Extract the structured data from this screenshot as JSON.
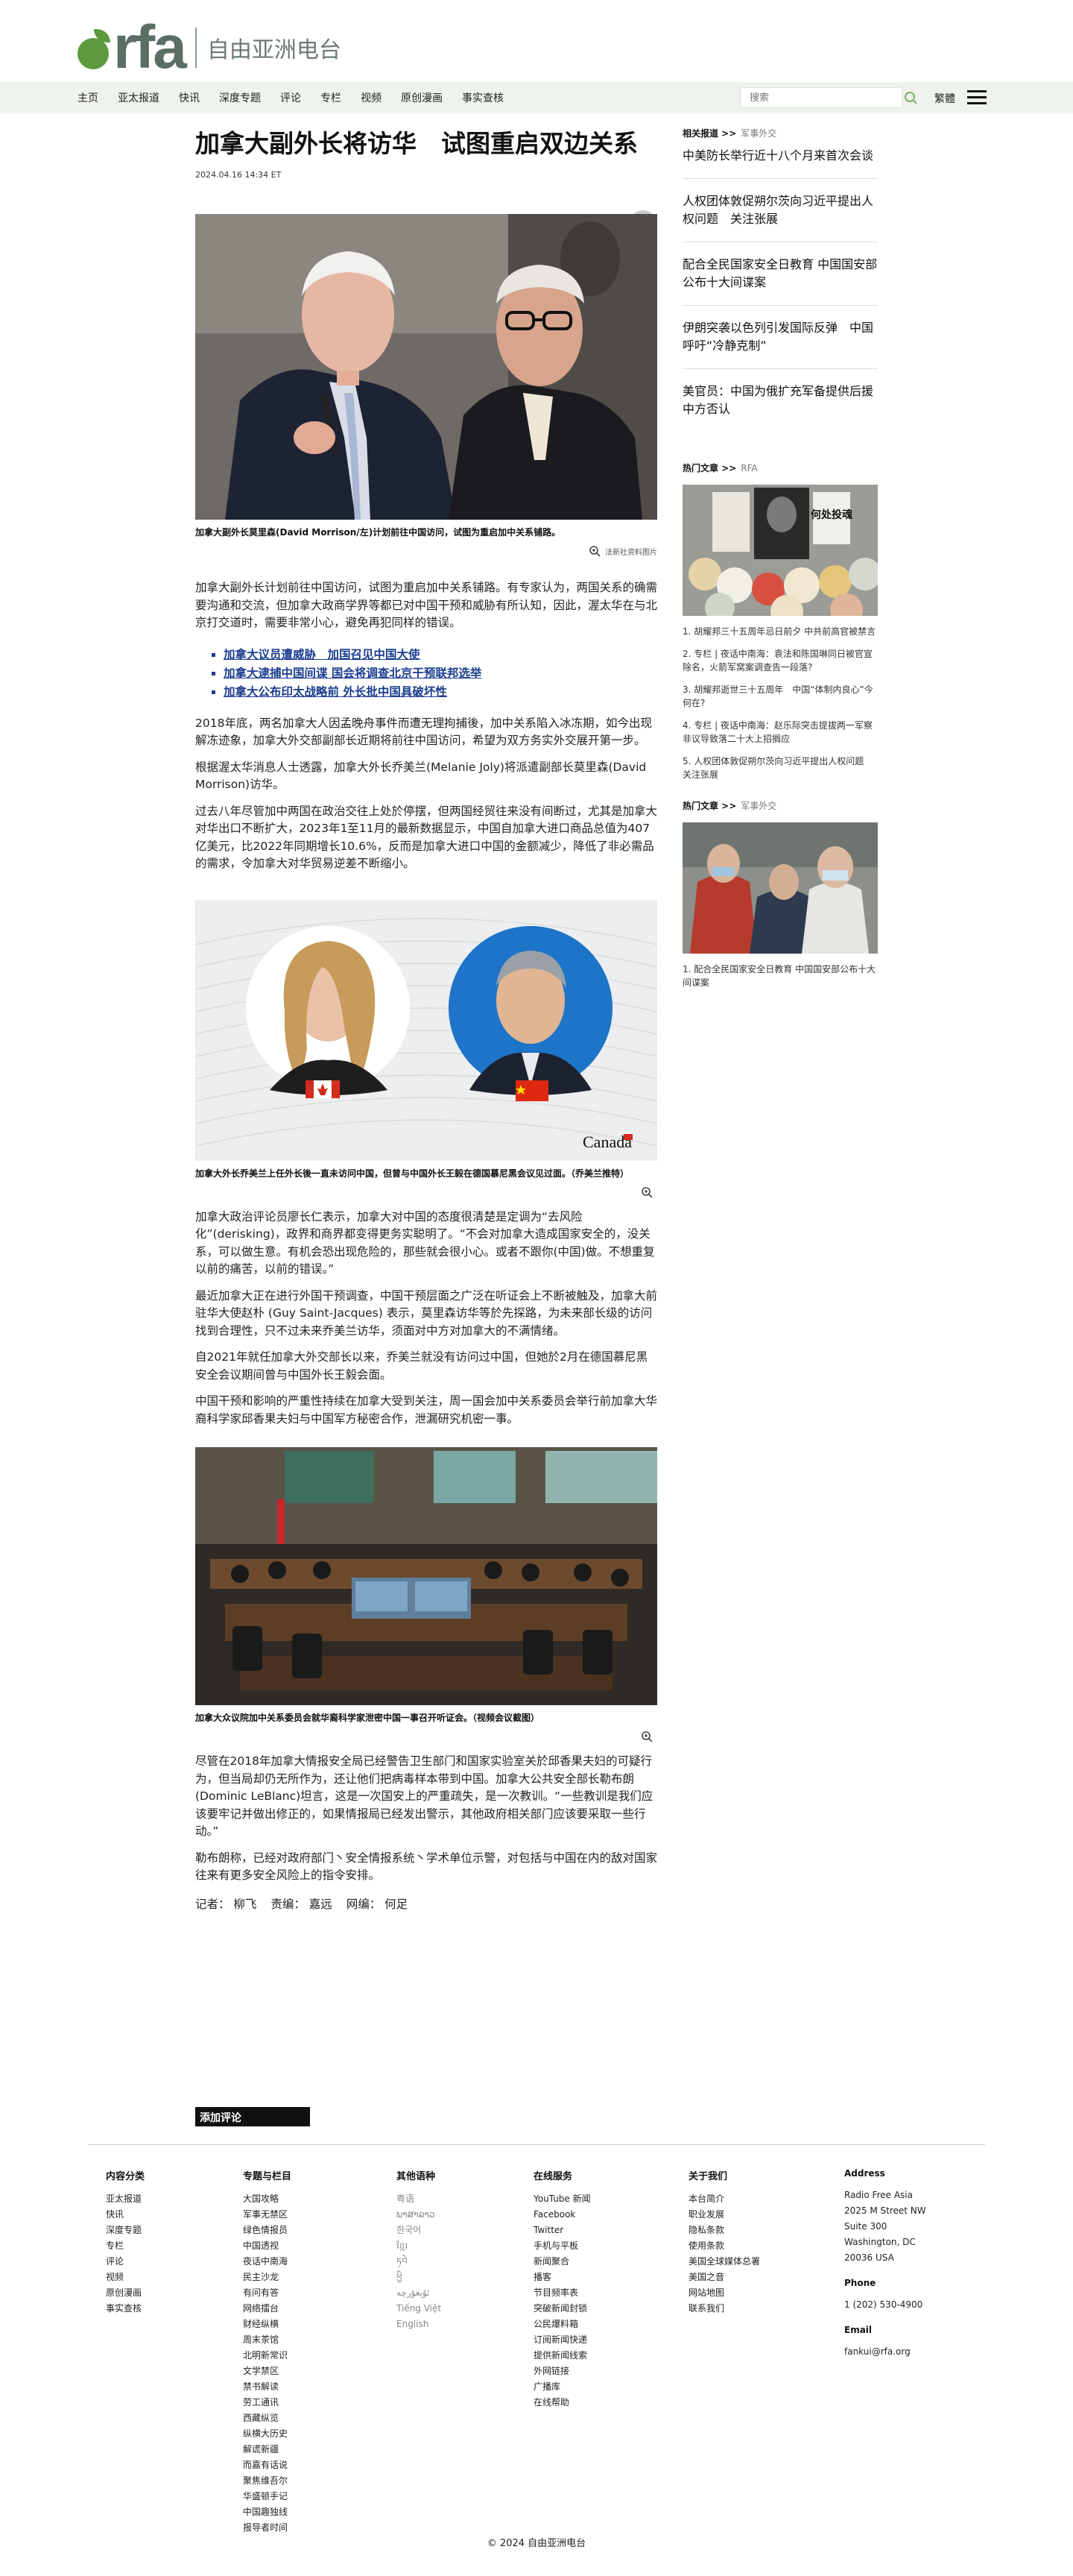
{
  "brand": {
    "logo_text": "rfa",
    "logo_cn": "自由亚洲电台"
  },
  "nav": {
    "items": [
      "主页",
      "亚太报道",
      "快讯",
      "深度专题",
      "评论",
      "专栏",
      "视频",
      "原创漫画",
      "事实查核"
    ],
    "search_placeholder": "搜索",
    "lang_label": "繁體"
  },
  "article": {
    "title": "加拿大副外长将访华　试图重启双边关系",
    "date": "2024.04.16 14:34 ET",
    "figure1": {
      "caption": "加拿大副外长莫里森(David Morrison/左)计划前往中国访问，试图为重启加中关系铺路。",
      "credit": "法新社资料图片"
    },
    "p1": "加拿大副外长计划前往中国访问，试图为重启加中关系铺路。有专家认为，两国关系的确需要沟通和交流，但加拿大政商学界等都已对中国干预和威胁有所认知，因此，渥太华在与北京打交道时，需要非常小心，避免再犯同样的错误。",
    "related": [
      "加拿大议员遭威胁　加国召见中国大使",
      "加拿大逮捕中国间谍 国会将调查北京干预联邦选举",
      "加拿大公布印太战略前 外长批中国具破坏性"
    ],
    "p2": "2018年底，两名加拿大人因孟晚舟事件而遭无理拘捕後，加中关系陷入冰冻期，如今出现解冻迹象，加拿大外交部副部长近期将前往中国访问，希望为双方务实外交展开第一步。",
    "p3": "根据渥太华消息人士透露，加拿大外长乔美兰(Melanie Joly)将派遣副部长莫里森(David Morrison)访华。",
    "p4": "过去八年尽管加中两国在政治交往上处於停摆，但两国经贸往来没有间断过，尤其是加拿大对华出口不断扩大，2023年1至11月的最新数据显示，中国自加拿大进口商品总值为407亿美元，比2022年同期增长10.6%，反而是加拿大进口中国的金额减少，降低了非必需品的需求，令加拿大对华贸易逆差不断缩小。",
    "figure2": {
      "caption": "加拿大外长乔美兰上任外长後一直未访问中国，但曾与中国外长王毅在德国慕尼黑会议见过面。（乔美兰推特）",
      "watermark": "Canada"
    },
    "p5": "加拿大政治评论员廖长仁表示，加拿大对中国的态度很清楚是定调为“去风险化”(derisking)，政界和商界都变得更务实聪明了。“不会对加拿大造成国家安全的，没关系，可以做生意。有机会恐出现危险的，那些就会很小心。或者不跟你(中国)做。不想重复以前的痛苦，以前的错误。”",
    "p6": "最近加拿大正在进行外国干预调查，中国干预层面之广泛在听证会上不断被触及，加拿大前驻华大使赵朴 (Guy Saint-Jacques) 表示，莫里森访华等於先探路，为未来部长级的访问找到合理性，只不过未来乔美兰访华，须面对中方对加拿大的不满情绪。",
    "p7": "自2021年就任加拿大外交部长以来，乔美兰就没有访问过中国，但她於2月在德国慕尼黑安全会议期间曾与中国外长王毅会面。",
    "p8": "中国干预和影响的严重性持续在加拿大受到关注，周一国会加中关系委员会举行前加拿大华裔科学家邱香果夫妇与中国军方秘密合作，泄漏研究机密一事。",
    "figure3": {
      "caption": "加拿大众议院加中关系委员会就华裔科学家泄密中国一事召开听证会。（视频会议截图）"
    },
    "p9": "尽管在2018年加拿大情报安全局已经警告卫生部门和国家实验室关於邱香果夫妇的可疑行为，但当局却仍无所作为，还让他们把病毒样本带到中国。加拿大公共安全部长勒布朗(Dominic LeBlanc)坦言，这是一次国安上的严重疏失，是一次教训。“一些教训是我们应该要牢记并做出修正的，如果情报局已经发出警示，其他政府相关部门应该要采取一些行动。”",
    "p10": "勒布朗称，已经对政府部门丶安全情报系统丶学术单位示警，对包括与中国在内的敌对国家往来有更多安全风险上的指令安排。",
    "credits": [
      "记者： 柳飞",
      "责编： 嘉远",
      "网编： 何足"
    ],
    "comment_button": "添加评论"
  },
  "sidebar": {
    "related_label": "相关报道 >>",
    "related_sub": "军事外交",
    "related_news": [
      "中美防长举行近十八个月来首次会谈",
      "人权团体敦促朔尔茨向习近平提出人权问题　关注张展",
      "配合全民国家安全日教育 中国国安部公布十大间谍案",
      "伊朗突袭以色列引发国际反弹　中国呼吁“冷静克制”",
      "美官员：中国为俄扩充军备提供后援 中方否认"
    ],
    "hot_label": "热门文章 >>",
    "hot_sub": "RFA",
    "hot_image_text": "何处投魂",
    "hot_list": [
      "1. 胡耀邦三十五周年忌日前夕 中共前高官被禁言",
      "2. 专栏 | 夜话中南海：袁法和陈国琳同日被官宣除名，火箭军窝案调查告一段落?",
      "3. 胡耀邦逝世三十五周年　中国“体制内良心”今何在?",
      "4. 专栏 | 夜话中南海：赵乐际突击提拔两一军察非议导致落二十大上招搁应",
      "5. 人权团体敦促朔尔茨向习近平提出人权问题　关注张展"
    ],
    "hot2_label": "热门文章 >>",
    "hot2_sub": "军事外交",
    "hot2_list": [
      "1. 配合全民国家安全日教育 中国国安部公布十大间谍案"
    ]
  },
  "footer": {
    "col1": {
      "title": "内容分类",
      "items": [
        "亚太报道",
        "快讯",
        "深度专题",
        "专栏",
        "评论",
        "视频",
        "原创漫画",
        "事实查核"
      ]
    },
    "col2": {
      "title": "专题与栏目",
      "items": [
        "大国攻略",
        "军事无禁区",
        "绿色情报员",
        "中国透视",
        "夜话中南海",
        "民主沙龙",
        "有问有答",
        "网络擂台",
        "财经纵横",
        "周末茶馆",
        "北明新常识",
        "文学禁区",
        "禁书解读",
        "劳工通讯",
        "西藏纵览",
        "纵横大历史",
        "解谎新疆",
        "而嘉有话说",
        "聚焦维吾尔",
        "华盛顿手记",
        "中国趣独线",
        "报导者时间"
      ]
    },
    "col3": {
      "title": "其他语种",
      "items": [
        "粤语",
        "ພາສາລາວ",
        "한국어",
        "ខ្មែរ",
        "ཏབེ",
        "ཕྱི",
        "ئۇيغۇرچە",
        "Tiếng Việt",
        "English"
      ]
    },
    "col4": {
      "title": "在线服务",
      "items": [
        "YouTube 新闻",
        "Facebook",
        "Twitter",
        "手机与平板",
        "新闻聚合",
        "播客",
        "节目频率表",
        "突破新闻封锁",
        "公民爆料箱",
        "订阅新闻快递",
        "提供新闻线索",
        "外网链接",
        "广播库",
        "在线帮助"
      ]
    },
    "col5": {
      "title": "关于我们",
      "items": [
        "本台简介",
        "职业发展",
        "隐私条款",
        "使用条款",
        "美国全球媒体总署",
        "美国之音",
        "网站地图",
        "联系我们"
      ]
    },
    "address_title": "Address",
    "address_lines": [
      "Radio Free Asia",
      "2025 M Street NW",
      "Suite 300",
      "Washington, DC",
      "20036 USA"
    ],
    "phone_title": "Phone",
    "phone": "1 (202) 530-4900",
    "email_title": "Email",
    "email": "fankui@rfa.org",
    "copyright": "© 2024 自由亚洲电台"
  }
}
